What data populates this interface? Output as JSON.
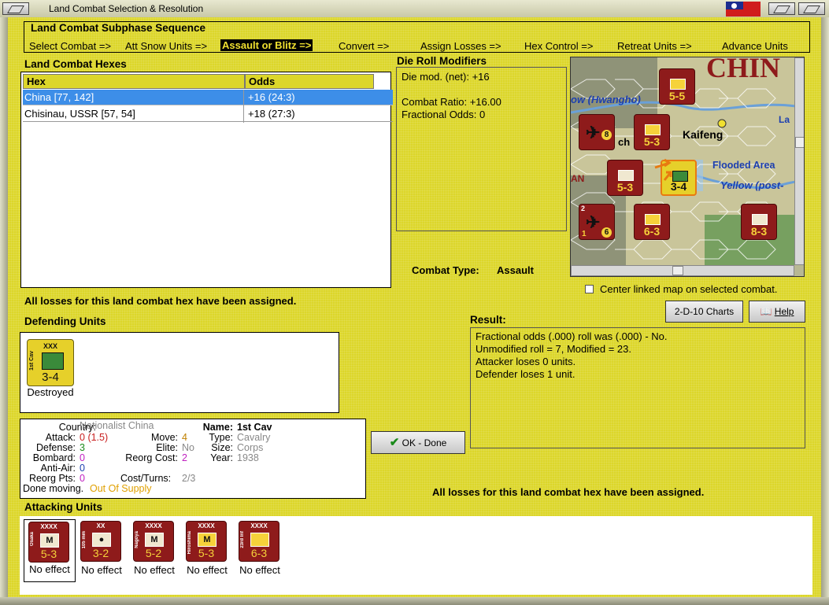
{
  "window": {
    "title": "Land Combat Selection & Resolution"
  },
  "subphase": {
    "heading": "Land Combat Subphase Sequence",
    "steps": [
      "Select Combat =>",
      "Att Snow Units =>",
      "Assault or Blitz =>",
      "Convert =>",
      "Assign Losses =>",
      "Hex Control =>",
      "Retreat Units =>",
      "Advance Units"
    ]
  },
  "hexes": {
    "heading": "Land Combat Hexes",
    "columns": [
      "Hex",
      "Odds"
    ],
    "rows": [
      {
        "hex": "China [77, 142]",
        "odds": "+16 (24:3)"
      },
      {
        "hex": "Chisinau, USSR [57, 54]",
        "odds": "+18 (27:3)"
      }
    ]
  },
  "die_roll": {
    "heading": "Die Roll Modifiers",
    "lines": [
      "Die mod. (net): +16",
      "",
      "Combat Ratio: +16.00",
      "Fractional Odds: 0"
    ]
  },
  "combat_type": {
    "label": "Combat Type:",
    "value": "Assault"
  },
  "map": {
    "labels": [
      "CHIN",
      "ow (Hwangho)",
      "Kaifeng",
      "Flooded Area",
      "Yellow (post-",
      "La",
      "ch",
      "AN"
    ]
  },
  "center_map": {
    "label": "Center linked map on selected combat."
  },
  "losses_assigned_msg": "All losses for this land combat hex have been assigned.",
  "buttons": {
    "charts": "2-D-10 Charts",
    "help": "Help",
    "ok": "OK - Done"
  },
  "defending": {
    "heading": "Defending Units",
    "units": [
      {
        "size": "XXX",
        "name": "1st Cav",
        "value": "3-4",
        "status": "Destroyed"
      }
    ]
  },
  "result": {
    "heading": "Result:",
    "lines": [
      "Fractional odds (.000) roll was (.000)  - No.",
      "Unmodified roll = 7, Modified = 23.",
      "Attacker loses 0 units.",
      "Defender loses 1 unit."
    ]
  },
  "details": {
    "country_k": "Country:",
    "country_v": "Nationalist China",
    "attack_k": "Attack:",
    "attack_v": "0",
    "attack_v2": "(1.5)",
    "defense_k": "Defense:",
    "defense_v": "3",
    "bombard_k": "Bombard:",
    "bombard_v": "0",
    "antiair_k": "Anti-Air:",
    "antiair_v": "0",
    "reorgpts_k": "Reorg Pts:",
    "reorgpts_v": "0",
    "done_k": "Done moving.",
    "done_v": "Out Of Supply",
    "move_k": "Move:",
    "move_v": "4",
    "elite_k": "Elite:",
    "elite_v": "No",
    "reorgcost_k": "Reorg Cost:",
    "reorgcost_v": "2",
    "costturns_k": "Cost/Turns:",
    "costturns_v": "2/3",
    "name_k": "Name:",
    "name_v": "1st Cav",
    "type_k": "Type:",
    "type_v": "Cavalry",
    "size_k": "Size:",
    "size_v": "Corps",
    "year_k": "Year:",
    "year_v": "1938"
  },
  "attacking": {
    "heading": "Attacking Units",
    "units": [
      {
        "size": "XXXX",
        "name": "Osaka",
        "symbol": "M",
        "value": "5-3",
        "status": "No effect"
      },
      {
        "size": "XX",
        "name": "105 mm",
        "symbol": "●",
        "value": "3-2",
        "status": "No effect"
      },
      {
        "size": "XXXX",
        "name": "Nagoya",
        "symbol": "M",
        "value": "5-2",
        "status": "No effect"
      },
      {
        "size": "XXXX",
        "name": "Hiroshima",
        "symbol": "M",
        "value": "5-3",
        "status": "No effect"
      },
      {
        "size": "XXXX",
        "name": "23rd Inf",
        "symbol": "",
        "value": "6-3",
        "status": "No effect"
      }
    ]
  },
  "map_counters": [
    "5-5",
    "5-3",
    "5-3",
    "3-4",
    "6-3",
    "8-3",
    "8",
    "2",
    "6",
    "1"
  ],
  "colors": {
    "panel_bg": "#dcd62a",
    "selected_row": "#3d8ee8",
    "unit_red": "#8e1b1b",
    "unit_yellow": "#e6d02a"
  }
}
